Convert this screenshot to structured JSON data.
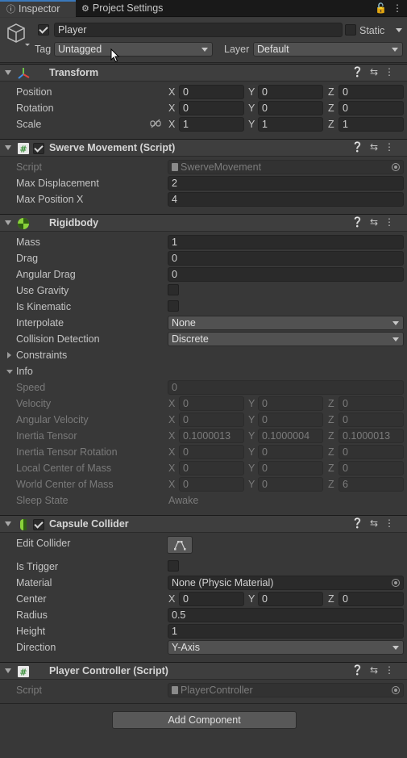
{
  "tabs": {
    "inspector": "Inspector",
    "project_settings": "Project Settings"
  },
  "icons": {
    "lock": "lock-icon",
    "menu": "kebab-menu-icon",
    "help": "help-icon",
    "preset": "preset-icon",
    "more": "more-icon"
  },
  "header": {
    "name": "Player",
    "active": true,
    "static_label": "Static",
    "static": false,
    "tag_label": "Tag",
    "tag": "Untagged",
    "layer_label": "Layer",
    "layer": "Default"
  },
  "transform": {
    "title": "Transform",
    "position": {
      "label": "Position",
      "x": "0",
      "y": "0",
      "z": "0"
    },
    "rotation": {
      "label": "Rotation",
      "x": "0",
      "y": "0",
      "z": "0"
    },
    "scale": {
      "label": "Scale",
      "x": "1",
      "y": "1",
      "z": "1"
    },
    "axes": {
      "x": "X",
      "y": "Y",
      "z": "Z"
    }
  },
  "swerve": {
    "title": "Swerve Movement (Script)",
    "enabled": true,
    "script_label": "Script",
    "script": "SwerveMovement",
    "max_displacement_label": "Max Displacement",
    "max_displacement": "2",
    "max_position_x_label": "Max Position X",
    "max_position_x": "4"
  },
  "rigidbody": {
    "title": "Rigidbody",
    "mass_label": "Mass",
    "mass": "1",
    "drag_label": "Drag",
    "drag": "0",
    "angular_drag_label": "Angular Drag",
    "angular_drag": "0",
    "use_gravity_label": "Use Gravity",
    "use_gravity": false,
    "is_kinematic_label": "Is Kinematic",
    "is_kinematic": false,
    "interpolate_label": "Interpolate",
    "interpolate": "None",
    "collision_label": "Collision Detection",
    "collision": "Discrete",
    "constraints_label": "Constraints",
    "info_label": "Info",
    "info": {
      "speed_label": "Speed",
      "speed": "0",
      "velocity_label": "Velocity",
      "velocity": {
        "x": "0",
        "y": "0",
        "z": "0"
      },
      "angular_velocity_label": "Angular Velocity",
      "angular_velocity": {
        "x": "0",
        "y": "0",
        "z": "0"
      },
      "inertia_tensor_label": "Inertia Tensor",
      "inertia_tensor": {
        "x": "0.1000013",
        "y": "0.1000004",
        "z": "0.1000013"
      },
      "inertia_rotation_label": "Inertia Tensor Rotation",
      "inertia_rotation": {
        "x": "0",
        "y": "0",
        "z": "0"
      },
      "local_com_label": "Local Center of Mass",
      "local_com": {
        "x": "0",
        "y": "0",
        "z": "0"
      },
      "world_com_label": "World Center of Mass",
      "world_com": {
        "x": "0",
        "y": "0",
        "z": "6"
      },
      "sleep_state_label": "Sleep State",
      "sleep_state": "Awake"
    }
  },
  "capsule": {
    "title": "Capsule Collider",
    "enabled": true,
    "edit_collider_label": "Edit Collider",
    "is_trigger_label": "Is Trigger",
    "is_trigger": false,
    "material_label": "Material",
    "material": "None (Physic Material)",
    "center_label": "Center",
    "center": {
      "x": "0",
      "y": "0",
      "z": "0"
    },
    "radius_label": "Radius",
    "radius": "0.5",
    "height_label": "Height",
    "height": "1",
    "direction_label": "Direction",
    "direction": "Y-Axis"
  },
  "player_controller": {
    "title": "Player Controller (Script)",
    "script_label": "Script",
    "script": "PlayerController"
  },
  "add_component": "Add Component",
  "colors": {
    "background": "#383838",
    "field": "#2a2a2a",
    "accent": "#3a79bb"
  }
}
